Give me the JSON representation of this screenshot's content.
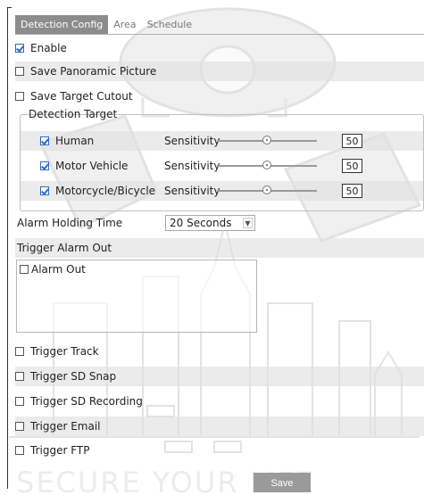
{
  "tabs": [
    {
      "label": "Detection Config",
      "active": true
    },
    {
      "label": "Area",
      "active": false
    },
    {
      "label": "Schedule",
      "active": false
    }
  ],
  "enable": {
    "label": "Enable",
    "checked": true
  },
  "save_panoramic": {
    "label": "Save Panoramic Picture",
    "checked": false
  },
  "save_target_cutout": {
    "label": "Save Target Cutout",
    "checked": false
  },
  "detection_target": {
    "legend": "Detection Target",
    "items": [
      {
        "label": "Human",
        "checked": true,
        "sensitivity_label": "Sensitivity",
        "value": "50",
        "level": 50
      },
      {
        "label": "Motor Vehicle",
        "checked": true,
        "sensitivity_label": "Sensitivity",
        "value": "50",
        "level": 50
      },
      {
        "label": "Motorcycle/Bicycle",
        "checked": true,
        "sensitivity_label": "Sensitivity",
        "value": "50",
        "level": 50
      }
    ]
  },
  "alarm_holding": {
    "label": "Alarm Holding Time",
    "value": "20 Seconds"
  },
  "trigger_alarm_out": {
    "label": "Trigger Alarm Out",
    "items": [
      {
        "label": "Alarm Out",
        "checked": false
      }
    ]
  },
  "triggers": [
    {
      "label": "Trigger Track",
      "checked": false
    },
    {
      "label": "Trigger SD Snap",
      "checked": false
    },
    {
      "label": "Trigger SD Recording",
      "checked": false
    },
    {
      "label": "Trigger Email",
      "checked": false
    },
    {
      "label": "Trigger FTP",
      "checked": false
    }
  ],
  "save_label": "Save",
  "watermark_text": "SECURE YOUR LIFE",
  "colors": {
    "active_tab": "#8c8c8c",
    "save_button": "#9a9a9a",
    "checkbox": "#2f6ac0"
  }
}
